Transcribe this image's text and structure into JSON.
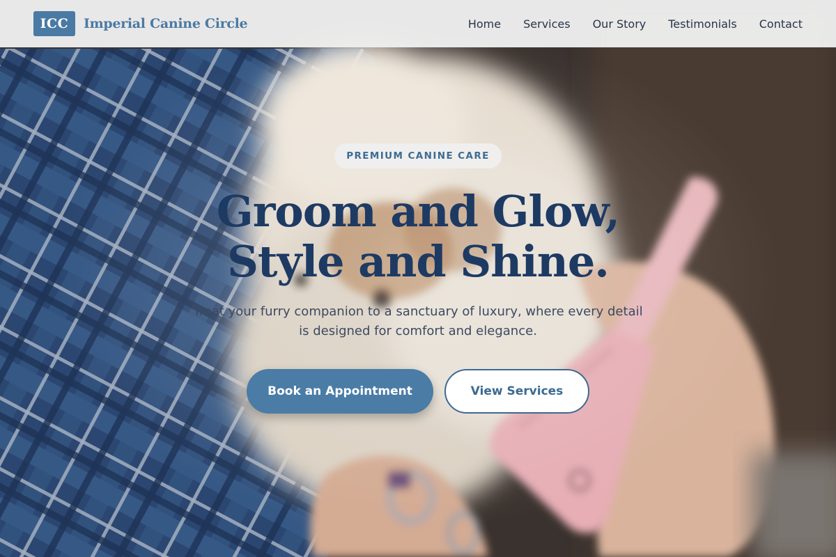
{
  "header": {
    "brand_badge": "ICC",
    "brand_name": "Imperial Canine Circle",
    "nav": [
      {
        "label": "Home"
      },
      {
        "label": "Services"
      },
      {
        "label": "Our Story"
      },
      {
        "label": "Testimonials"
      },
      {
        "label": "Contact"
      }
    ]
  },
  "hero": {
    "pill": "PREMIUM CANINE CARE",
    "title_line1": "Groom and Glow,",
    "title_line2": "Style and Shine.",
    "subtitle": "Treat your furry companion to a sanctuary of luxury, where every detail is designed for comfort and elegance.",
    "primary_button": "Book an Appointment",
    "secondary_button": "View Services",
    "background_image": "dog-being-brushed-photo"
  },
  "colors": {
    "accent": "#4a7aa3",
    "heading": "#1d3a63",
    "nav_text": "#283448",
    "nav_bg": "#eeeeee"
  }
}
